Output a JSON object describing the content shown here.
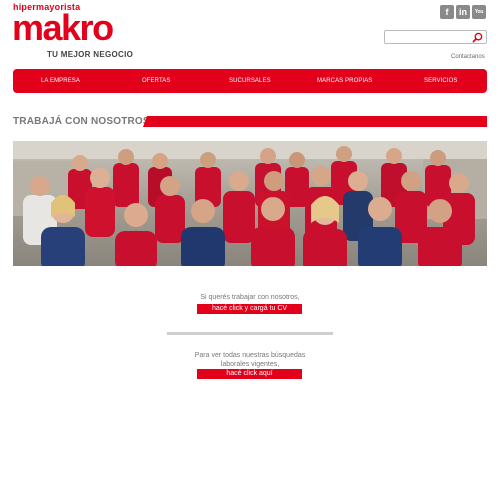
{
  "brand": {
    "tagline_top": "hipermayorista",
    "name": "makro",
    "tagline_bottom": "TU MEJOR NEGOCIO",
    "accent": "#e3001b"
  },
  "social": {
    "facebook": "f",
    "linkedin": "in",
    "youtube": "You"
  },
  "search": {
    "value": "",
    "placeholder": ""
  },
  "header": {
    "contact_label": "Contactanos"
  },
  "nav": {
    "items": [
      {
        "label": "LA EMPRESA"
      },
      {
        "label": "OFERTAS"
      },
      {
        "label": "SUCURSALES"
      },
      {
        "label": "MARCAS PROPIAS"
      },
      {
        "label": "SERVICIOS"
      }
    ]
  },
  "main": {
    "section_title": "TRABAJÁ CON NOSOTROS",
    "cv_text": "Si querés trabajar con nosotros,",
    "cv_button": "hacé click y cargá tu CV",
    "jobs_text_1": "Para ver todas nuestras búsquedas",
    "jobs_text_2": "laborales vigentes,",
    "jobs_button": "hacé click aquí"
  }
}
